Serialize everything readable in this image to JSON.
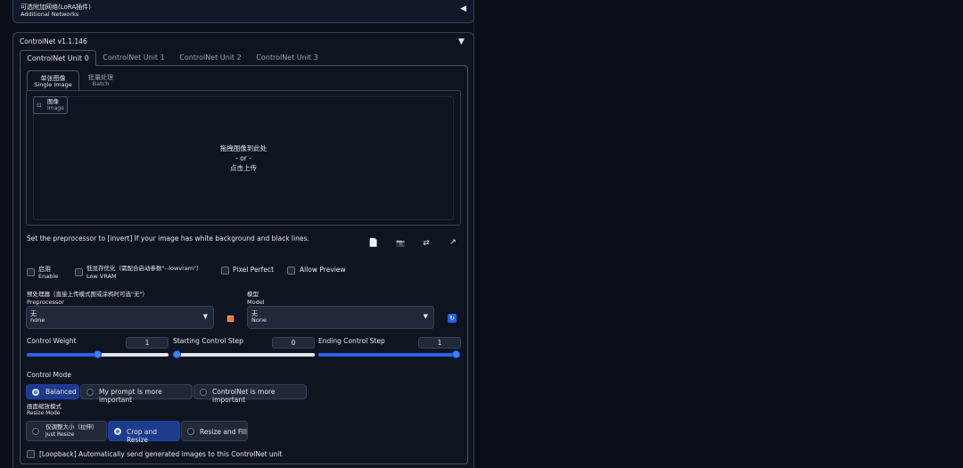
{
  "lora": {
    "title": "可选附加网络(LoRA插件)",
    "subtitle": "Additional Networks",
    "toggle_icon": "triangle-left-icon"
  },
  "controlnet": {
    "title": "ControlNet v1.1.146",
    "toggle_icon": "triangle-down-icon",
    "unit_tabs": [
      "ControlNet Unit 0",
      "ControlNet Unit 1",
      "ControlNet Unit 2",
      "ControlNet Unit 3"
    ],
    "image_tabs": [
      {
        "main": "单张图像",
        "sub": "Single Image"
      },
      {
        "main": "批量处理",
        "sub": "Batch"
      }
    ],
    "image_label": {
      "main": "图像",
      "sub": "Image",
      "icon": "image-icon"
    },
    "drop": {
      "line1": "拖拽图像到此处",
      "line2": "- or -",
      "line3": "点击上传"
    },
    "hint": "Set the preprocessor to [invert] If your image has white background and black lines.",
    "tool_icons": [
      "new-canvas-icon",
      "webcam-icon",
      "swap-icon",
      "send-dimensions-icon"
    ],
    "checkboxes": {
      "enable": {
        "main": "启用",
        "sub": "Enable"
      },
      "low_vram": {
        "main": "低显存优化（需配合启动参数\"--lowvram\"）",
        "sub": "Low VRAM"
      },
      "pixel_perfect": "Pixel Perfect",
      "allow_preview": "Allow Preview"
    },
    "preprocessor": {
      "label_main": "预处理器（直接上传模式图或涂鸦时可选\"无\"）",
      "label_sub": "Preprocessor",
      "value_main": "无",
      "value_sub": "none"
    },
    "model": {
      "label_main": "模型",
      "label_sub": "Model",
      "value_main": "无",
      "value_sub": "None"
    },
    "sliders": {
      "weight": {
        "label": "Control Weight",
        "value": "1",
        "fraction": 0.5
      },
      "start": {
        "label": "Starting Control Step",
        "value": "0",
        "fraction": 0.0
      },
      "end": {
        "label": "Ending Control Step",
        "value": "1",
        "fraction": 1.0
      }
    },
    "control_mode": {
      "label": "Control Mode",
      "options": [
        "Balanced",
        "My prompt is more important",
        "ControlNet is more important"
      ],
      "selected": 0
    },
    "resize_mode": {
      "label_main": "画面缩放模式",
      "label_sub": "Resize Mode",
      "options": [
        {
          "main": "仅调整大小（拉伸）",
          "sub": "Just Resize"
        },
        {
          "main": "Crop and Resize",
          "sub": ""
        },
        {
          "main": "Resize and Fill",
          "sub": ""
        }
      ],
      "selected": 1
    },
    "loopback": "[Loopback] Automatically send generated images to this ControlNet unit",
    "colors": {
      "accent": "#3b82f6",
      "background": "#0b0f19",
      "panel": "#1f2937"
    }
  }
}
